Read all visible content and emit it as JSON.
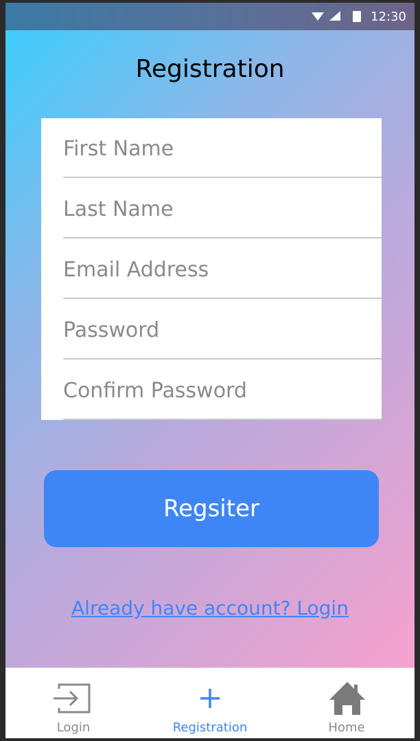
{
  "status_bar": {
    "time": "12:30"
  },
  "page": {
    "title": "Registration"
  },
  "form": {
    "first_name": {
      "placeholder": "First Name",
      "value": ""
    },
    "last_name": {
      "placeholder": "Last Name",
      "value": ""
    },
    "email": {
      "placeholder": "Email Address",
      "value": ""
    },
    "password": {
      "placeholder": "Password",
      "value": ""
    },
    "confirm_password": {
      "placeholder": "Confirm Password",
      "value": ""
    },
    "submit_label": "Regsiter",
    "login_link": "Already have account? Login"
  },
  "tabs": [
    {
      "label": "Login",
      "icon": "login-icon",
      "active": false
    },
    {
      "label": "Registration",
      "icon": "plus-icon",
      "active": true
    },
    {
      "label": "Home",
      "icon": "home-icon",
      "active": false
    }
  ],
  "colors": {
    "accent": "#3e86f6",
    "inactive_tab": "#8a8a8a",
    "gradient_start": "#3ecdfc",
    "gradient_end": "#f7a1cf"
  }
}
